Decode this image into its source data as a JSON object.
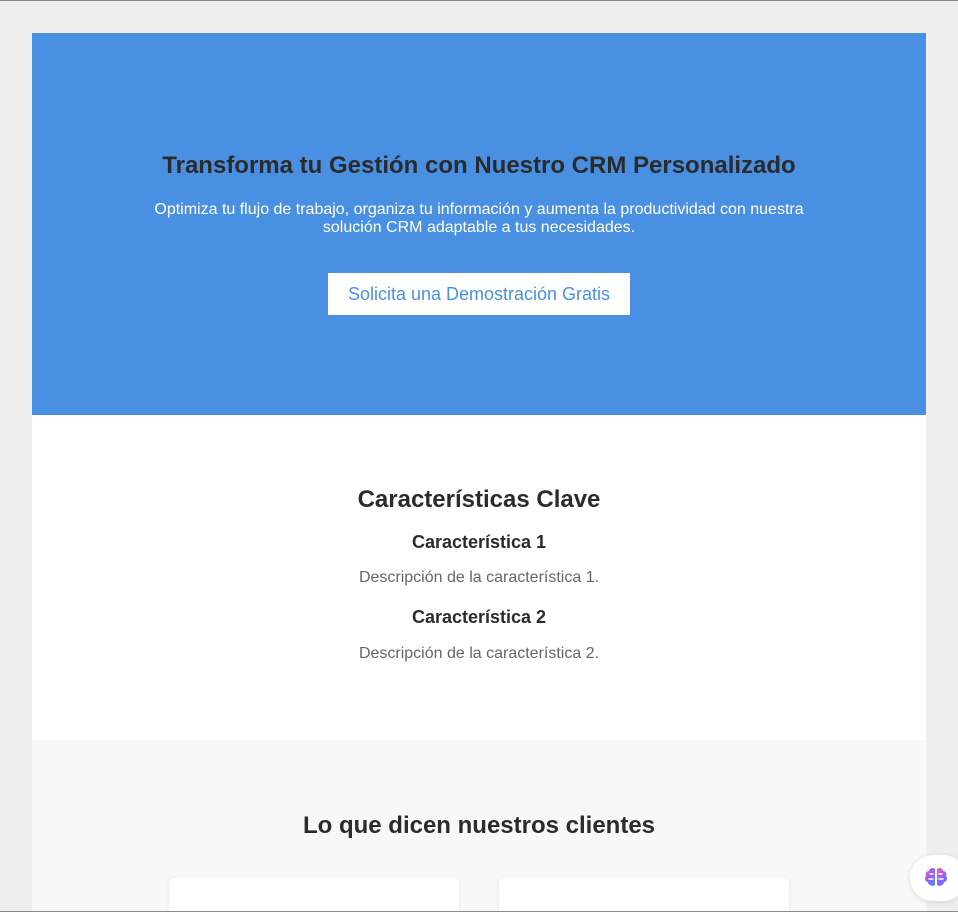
{
  "hero": {
    "title": "Transforma tu Gestión con Nuestro CRM Personalizado",
    "subtitle": "Optimiza tu flujo de trabajo, organiza tu información y aumenta la productividad con nuestra solución CRM adaptable a tus necesidades.",
    "cta_label": "Solicita una Demostración Gratis"
  },
  "features": {
    "title": "Características Clave",
    "items": [
      {
        "title": "Característica 1",
        "description": "Descripción de la característica 1."
      },
      {
        "title": "Característica 2",
        "description": "Descripción de la característica 2."
      }
    ]
  },
  "testimonials": {
    "title": "Lo que dicen nuestros clientes"
  },
  "floating_assistant": {
    "icon": "brain-icon"
  },
  "colors": {
    "hero_background": "#4a90e2",
    "page_background": "#efefef",
    "testimonials_background": "#f8f8f8",
    "heading_text": "#2b2b2b"
  }
}
